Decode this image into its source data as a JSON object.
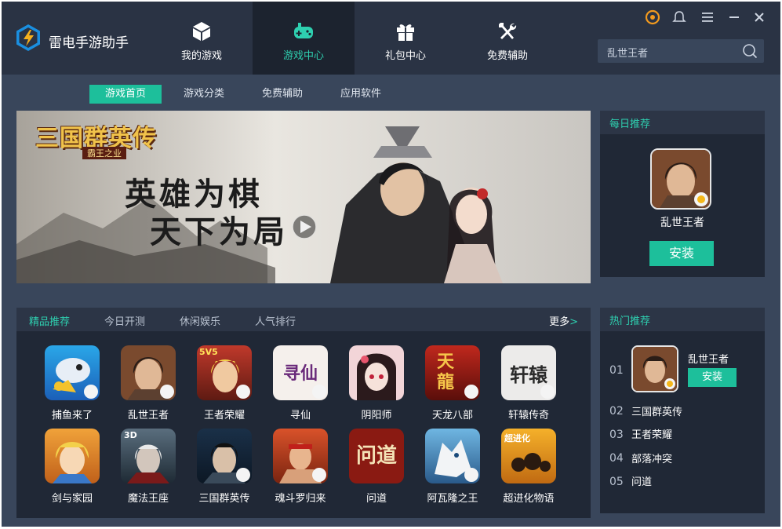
{
  "app": {
    "title": "雷电手游助手"
  },
  "nav": {
    "tabs": [
      {
        "label": "我的游戏",
        "icon": "cube-icon"
      },
      {
        "label": "游戏中心",
        "icon": "gamepad-icon",
        "active": true
      },
      {
        "label": "礼包中心",
        "icon": "gift-icon"
      },
      {
        "label": "免费辅助",
        "icon": "tools-icon"
      }
    ]
  },
  "search": {
    "value": "乱世王者",
    "icon": "search-icon"
  },
  "window_controls": [
    "skin-icon",
    "notification-icon",
    "menu-icon",
    "minimize-icon",
    "close-icon"
  ],
  "subnav": {
    "items": [
      {
        "label": "游戏首页",
        "active": true
      },
      {
        "label": "游戏分类"
      },
      {
        "label": "免费辅助"
      },
      {
        "label": "应用软件"
      }
    ]
  },
  "banner": {
    "logo_text": "三国群英传",
    "logo_sub": "霸王之业",
    "slogan_line1": "英雄为棋",
    "slogan_line2": "天下为局"
  },
  "daily": {
    "title": "每日推荐",
    "game_name": "乱世王者",
    "install_label": "安装"
  },
  "games_panel": {
    "tabs": [
      {
        "label": "精品推荐",
        "active": true
      },
      {
        "label": "今日开测"
      },
      {
        "label": "休闲娱乐"
      },
      {
        "label": "人气排行"
      }
    ],
    "more_label": "更多",
    "more_arrow": ">",
    "games": [
      {
        "name": "捕鱼来了"
      },
      {
        "name": "乱世王者"
      },
      {
        "name": "王者荣耀",
        "badge": "5V5"
      },
      {
        "name": "寻仙",
        "icon_text": "寻仙"
      },
      {
        "name": "阴阳师"
      },
      {
        "name": "天龙八部",
        "icon_text": "天龍"
      },
      {
        "name": "轩辕传奇",
        "icon_text": "轩辕"
      },
      {
        "name": "剑与家园"
      },
      {
        "name": "魔法王座",
        "badge": "3D"
      },
      {
        "name": "三国群英传"
      },
      {
        "name": "魂斗罗归来"
      },
      {
        "name": "问道",
        "icon_text": "问道"
      },
      {
        "name": "阿瓦隆之王"
      },
      {
        "name": "超进化物语",
        "icon_text": "超进化"
      }
    ]
  },
  "hot": {
    "title": "热门推荐",
    "top": {
      "rank": "01",
      "name": "乱世王者",
      "install_label": "安装"
    },
    "items": [
      {
        "rank": "02",
        "name": "三国群英传"
      },
      {
        "rank": "03",
        "name": "王者荣耀"
      },
      {
        "rank": "04",
        "name": "部落冲突"
      },
      {
        "rank": "05",
        "name": "问道"
      }
    ]
  }
}
